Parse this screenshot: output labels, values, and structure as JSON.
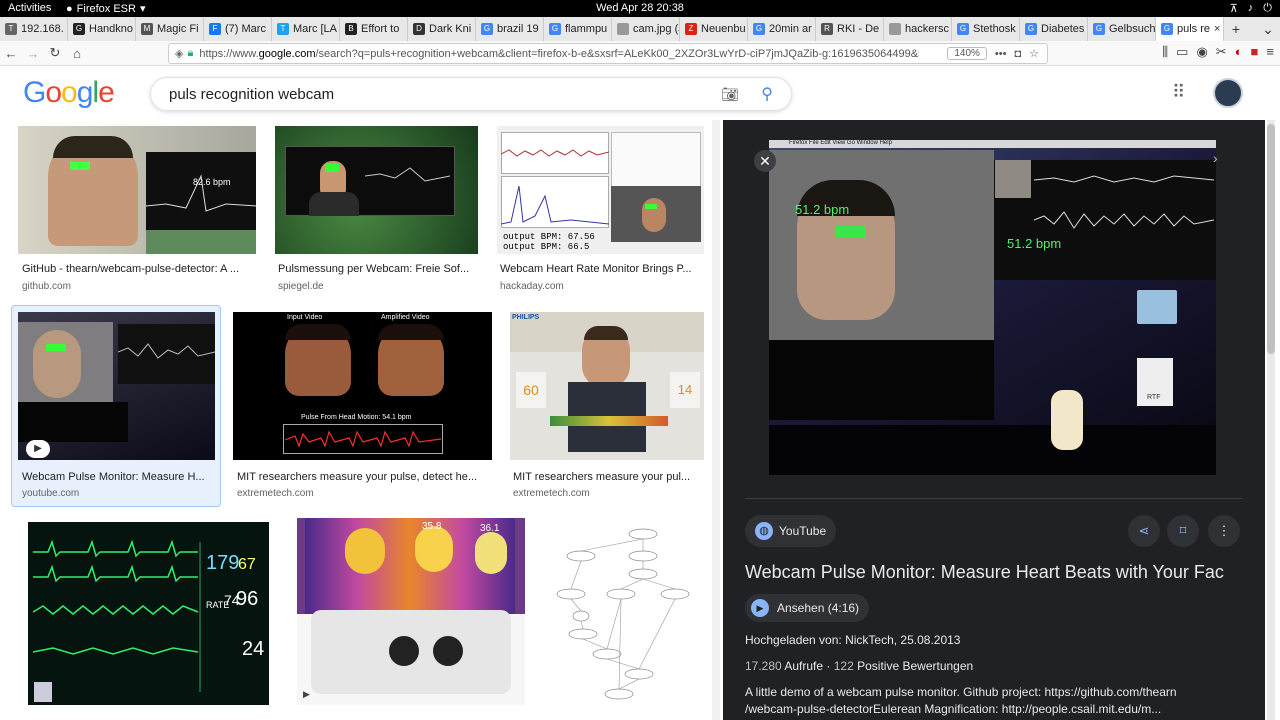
{
  "topbar": {
    "activities": "Activities",
    "app": "Firefox ESR",
    "clock": "Wed Apr 28  20:38",
    "tray": [
      "⊼",
      "♪",
      "⏻"
    ]
  },
  "tabs": [
    {
      "label": "192.168.",
      "icon": "triangle",
      "color": "#666"
    },
    {
      "label": "Handkno",
      "icon": "github",
      "color": "#222"
    },
    {
      "label": "Magic Fi",
      "icon": "m",
      "color": "#555"
    },
    {
      "label": "(7) Marc",
      "icon": "f",
      "color": "#1877f2"
    },
    {
      "label": "Marc [LA",
      "icon": "t",
      "color": "#1da1f2"
    },
    {
      "label": "Effort to",
      "icon": "b",
      "color": "#222"
    },
    {
      "label": "Dark Kni",
      "icon": "d",
      "color": "#333"
    },
    {
      "label": "brazil 19",
      "icon": "g",
      "color": "#4285f4"
    },
    {
      "label": "flammpu",
      "icon": "g",
      "color": "#4285f4"
    },
    {
      "label": "cam.jpg (JPE",
      "icon": "",
      "color": "#999"
    },
    {
      "label": "Neuenbu",
      "icon": "z",
      "color": "#d21"
    },
    {
      "label": "20min ar",
      "icon": "g",
      "color": "#4285f4"
    },
    {
      "label": "RKI - De",
      "icon": "r",
      "color": "#555"
    },
    {
      "label": "hackersc",
      "icon": "",
      "color": "#999"
    },
    {
      "label": "Stethosk",
      "icon": "g",
      "color": "#4285f4"
    },
    {
      "label": "Diabetes",
      "icon": "g",
      "color": "#4285f4"
    },
    {
      "label": "Gelbsuch",
      "icon": "g",
      "color": "#4285f4"
    },
    {
      "label": "puls re",
      "icon": "g",
      "color": "#4285f4",
      "active": true
    }
  ],
  "nav": {
    "url_prefix": "https://www.",
    "url_host": "google.com",
    "url_rest": "/search?q=puls+recognition+webcam&client=firefox-b-e&sxsrf=ALeKk00_2XZOr3LwYrD-ciP7jmJQaZib-g:1619635064499&source",
    "zoom": "140%",
    "dots": "•••"
  },
  "google": {
    "logo_letters": [
      [
        "G",
        "#4285f4"
      ],
      [
        "o",
        "#ea4335"
      ],
      [
        "o",
        "#fbbc05"
      ],
      [
        "g",
        "#4285f4"
      ],
      [
        "l",
        "#34a853"
      ],
      [
        "e",
        "#ea4335"
      ]
    ],
    "query": "puls recognition webcam"
  },
  "results": [
    {
      "title": "GitHub - thearn/webcam-pulse-detector: A ...",
      "source": "github.com"
    },
    {
      "title": "Pulsmessung per Webcam: Freie Sof...",
      "source": "spiegel.de"
    },
    {
      "title": "Webcam Heart Rate Monitor Brings P...",
      "source": "hackaday.com"
    },
    {
      "title": "Webcam Pulse Monitor: Measure H...",
      "source": "youtube.com"
    },
    {
      "title": "MIT researchers measure your pulse, detect he...",
      "source": "extremetech.com"
    },
    {
      "title": "MIT researchers measure your pul...",
      "source": "extremetech.com"
    }
  ],
  "thumbs": {
    "gh_bpm": "82.6 bpm",
    "hk_out": "output BPM:  67.56",
    "hk_out2": "output BPM:  66.5",
    "yt_bpm": "51.2 bpm",
    "mit_in": "Input Video",
    "mit_amp": "Amplified Video",
    "mit_pulse": "Pulse From Head Motion: 54.1 bpm",
    "ph_brand": "PHILIPS",
    "ph_60": "60",
    "ph_14": "14",
    "mon_values": [
      "179",
      "67",
      "74",
      "96",
      "24"
    ],
    "mon_rate": "RATE",
    "th_35": "35.8",
    "th_36": "36.1"
  },
  "panel": {
    "source": "YouTube",
    "title": "Webcam Pulse Monitor: Measure Heart Beats with Your Fac",
    "watch": "Ansehen (4:16)",
    "uploaded": "Hochgeladen von: NickTech, 25.08.2013",
    "views_n": "17.280",
    "views_l": "Aufrufe",
    "likes_n": "122",
    "likes_l": "Positive Bewertungen",
    "desc1": "A little demo of a webcam pulse monitor. Github project: https://github.com/thearn",
    "desc2": "/webcam-pulse-detectorEulerean Magnification: http://people.csail.mit.edu/m...",
    "img_bpm": "51.2 bpm",
    "img_bpm2": "51.2 bpm",
    "img_menu": "Firefox   File   Edit   View   Go   Window   Help",
    "rtf": "RTF"
  }
}
